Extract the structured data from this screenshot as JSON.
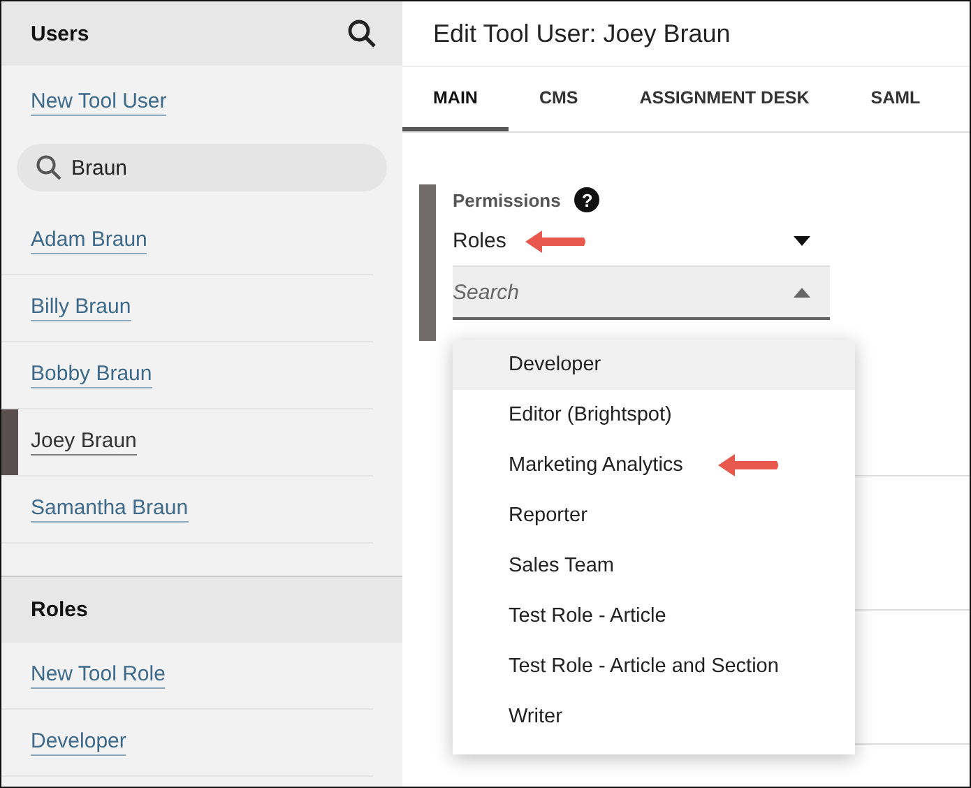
{
  "sidebar": {
    "users": {
      "title": "Users",
      "new_link": "New Tool User",
      "search": {
        "value": "Braun"
      },
      "items": [
        {
          "label": "Adam Braun",
          "selected": false
        },
        {
          "label": "Billy Braun",
          "selected": false
        },
        {
          "label": "Bobby Braun",
          "selected": false
        },
        {
          "label": "Joey Braun",
          "selected": true
        },
        {
          "label": "Samantha Braun",
          "selected": false
        }
      ]
    },
    "roles": {
      "title": "Roles",
      "items": [
        {
          "label": "New Tool Role"
        },
        {
          "label": "Developer"
        }
      ]
    }
  },
  "main": {
    "title": "Edit Tool User: Joey Braun",
    "tabs": [
      {
        "label": "MAIN",
        "selected": true
      },
      {
        "label": "CMS",
        "selected": false
      },
      {
        "label": "ASSIGNMENT DESK",
        "selected": false
      },
      {
        "label": "SAML",
        "selected": false
      }
    ],
    "permissions": {
      "label": "Permissions",
      "help": "?",
      "select": {
        "value": "Roles",
        "arrow": true
      },
      "search": {
        "placeholder": "Search"
      },
      "options": [
        {
          "label": "Developer",
          "selected": true,
          "arrow": false
        },
        {
          "label": "Editor (Brightspot)",
          "selected": false,
          "arrow": false
        },
        {
          "label": "Marketing Analytics",
          "selected": false,
          "arrow": true
        },
        {
          "label": "Reporter",
          "selected": false,
          "arrow": false
        },
        {
          "label": "Sales Team",
          "selected": false,
          "arrow": false
        },
        {
          "label": "Test Role - Article",
          "selected": false,
          "arrow": false
        },
        {
          "label": "Test Role - Article and Section",
          "selected": false,
          "arrow": false
        },
        {
          "label": "Writer",
          "selected": false,
          "arrow": false
        }
      ]
    }
  }
}
